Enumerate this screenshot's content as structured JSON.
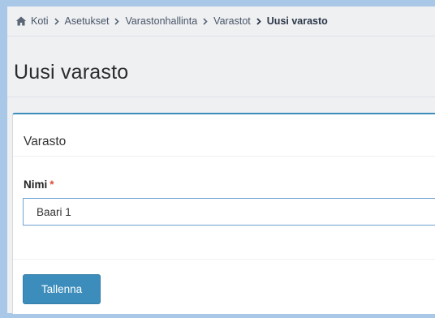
{
  "breadcrumb": {
    "items": [
      "Koti",
      "Asetukset",
      "Varastonhallinta",
      "Varastot"
    ],
    "current": "Uusi varasto"
  },
  "page": {
    "title": "Uusi varasto"
  },
  "form": {
    "card_title": "Varasto",
    "name_label": "Nimi",
    "required_marker": "*",
    "name_value": "Baari 1",
    "save_label": "Tallenna"
  },
  "colors": {
    "primary": "#3c8dbc",
    "required": "#dd4b39"
  },
  "icons": {
    "home": "home-icon",
    "separator": "chevron-right-icon"
  }
}
